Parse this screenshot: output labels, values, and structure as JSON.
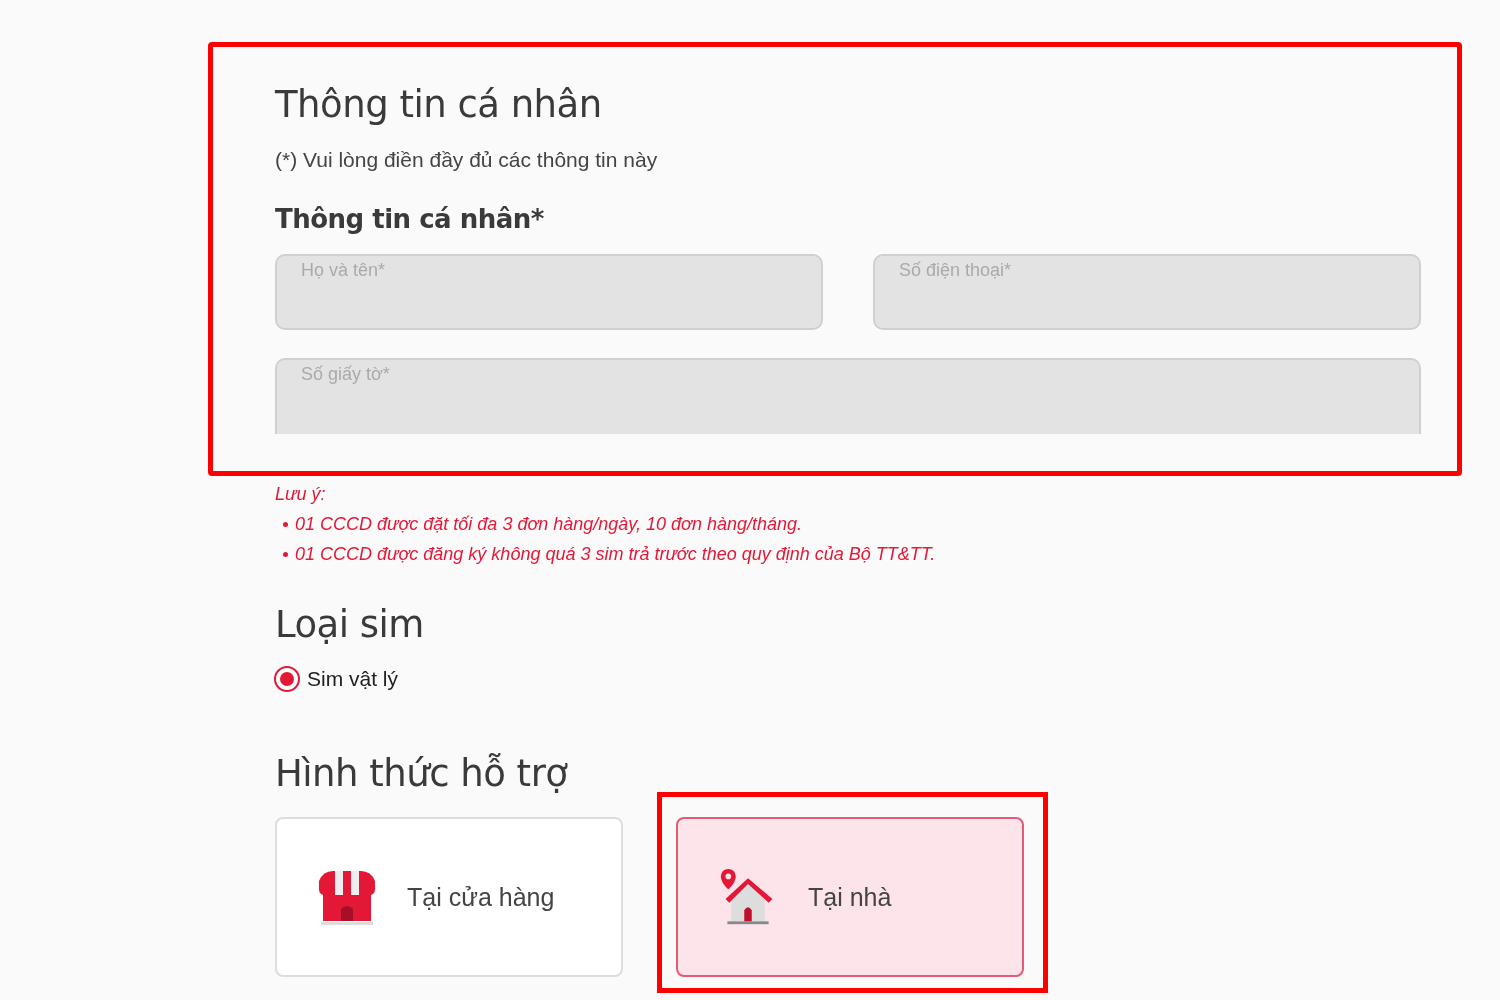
{
  "personal_info": {
    "highlighted": true,
    "title": "Thông tin cá nhân",
    "note": "(*) Vui lòng điền đầy đủ các thông tin này",
    "subtitle": "Thông tin cá nhân*",
    "fields": [
      {
        "label": "Họ và tên*",
        "disabled": true,
        "wide": false
      },
      {
        "label": "Số điện thoại*",
        "disabled": true,
        "wide": false
      },
      {
        "label": "Số giấy tờ*",
        "disabled": true,
        "wide": true
      }
    ]
  },
  "notice": {
    "title": "Lưu ý:",
    "items": [
      "01 CCCD được đặt tối đa 3 đơn hàng/ngày, 10 đơn hàng/tháng.",
      "01 CCCD được đăng ký không quá 3 sim trả trước theo quy định của Bộ TT&TT."
    ]
  },
  "sim_type": {
    "title": "Loại sim",
    "options": [
      {
        "label": "Sim vật lý",
        "selected": true
      }
    ]
  },
  "support": {
    "title": "Hình thức hỗ trợ",
    "options": [
      {
        "kind": "store",
        "label": "Tại cửa hàng",
        "selected": false,
        "highlighted": false
      },
      {
        "kind": "home",
        "label": "Tại nhà",
        "selected": true,
        "highlighted": true
      }
    ]
  }
}
